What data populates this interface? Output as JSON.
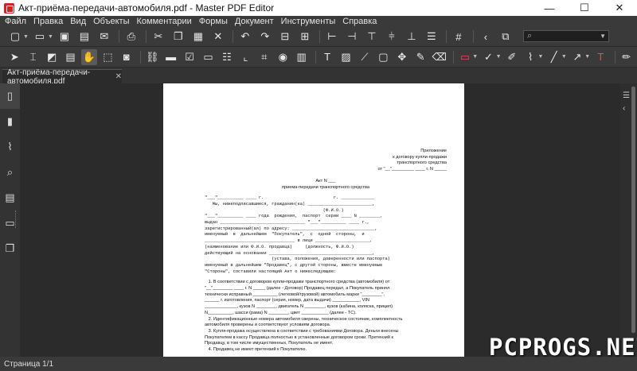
{
  "window": {
    "title": "Акт-приёма-передачи-автомобиля.pdf - Master PDF Editor",
    "minimize": "—",
    "maximize": "☐",
    "close": "✕"
  },
  "menu": [
    "Файл",
    "Правка",
    "Вид",
    "Объекты",
    "Комментарии",
    "Формы",
    "Документ",
    "Инструменты",
    "Справка"
  ],
  "search": {
    "value": "",
    "icon": "search-icon"
  },
  "tab": {
    "label": "Акт-приёма-передачи-автомобиля.pdf",
    "close_glyph": "✕"
  },
  "status": {
    "page": "Страница 1/1"
  },
  "watermark": "PCPROGS.NET",
  "document": {
    "appendix": [
      "Приложение",
      "к договору купли-продажи",
      "транспортного средства",
      "от \"__\"_________ ____ г. N _____"
    ],
    "act_title": "Акт N ___",
    "act_subtitle": "приема-передачи транспортного средства",
    "lines": [
      "\"___\"__________ ____ г.                           г. _____________",
      "",
      "   Мы, нижеподписавшиеся, гражданин(ка) _________________________,",
      "                                              (Ф.И.О.)",
      "\"___\"__________ ____ года  рождения,  паспорт  серии ____ N ________,",
      "выдан _________________________________ \"___\"__________ ____ г.,",
      "зарегистрированный(ая) по адресу: ________________________________,",
      "именуемый  в  дальнейшем  \"Покупатель\",  с  одной  стороны,  и",
      "___________________________________ в лице _____________________,",
      "(наименование или Ф.И.О. продавца)     (должность, Ф.И.О.)",
      "действующий на основании ________________________________________,",
      "                          (устава, положения, доверенности или паспорта)",
      "именуемый в дальнейшем \"Продавец\", с другой стороны, вместе именуемые",
      "\"Стороны\", составили настоящий Акт о нижеследующем:"
    ],
    "clauses": [
      "   1. В соответствии с договором купли-продажи транспортного средства (автомобиля) от",
      "\"__\"________ ____ г. N _____ (далее - Договор) Продавец передал, а Покупатель принял",
      "технически исправный __________ (легковой/грузовой) автомобиль марки \"________\",",
      "______ г. изготовления, паспорт (серия, номер, дата выдачи) ___________, VIN",
      "_____________, кузов N ________, двигатель N ________, кузов (кабина, коляска, прицеп)",
      "N__________, шасси (рама) N ________, цвет ___________ (далее - ТС).",
      "   2. Идентификационные номера автомобиля сверены, техническое состояние, комплектность",
      "автомобиля проверены и соответствуют условиям договора.",
      "   3. Купля-продажа осуществлена в соответствии с требованиями Договора. Деньги внесены",
      "Покупателем в кассу Продавца полностью в установленные договором сроки. Претензий к",
      "Продавцу, в том числе имущественных, Покупатель не имеет.",
      "   4. Продавец не имеет претензий к Покупателю."
    ]
  }
}
